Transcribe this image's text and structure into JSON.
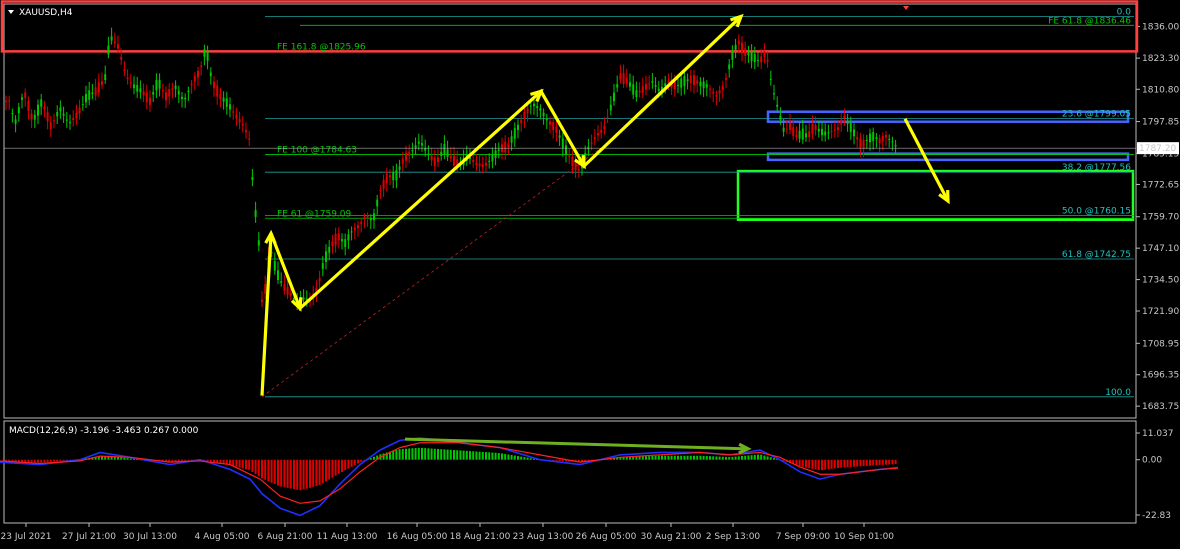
{
  "window": {
    "symbol_label": "XAUUSD,H4"
  },
  "colors": {
    "background": "#000000",
    "bull": "#00c800",
    "bear": "#e00000",
    "fib": "#20a0a0",
    "fib_text": "#20c0c0",
    "fe": "#00c800",
    "price_line": "#aaaaaa",
    "arrow": "#ffff00",
    "resistance_box": "#ff4040",
    "support_box": "#20ff20",
    "range_box": "#4466ff",
    "macd_line": "#2030ff",
    "signal_line": "#ff2020",
    "divergence": "#6fb020"
  },
  "chart_data": [
    {
      "type": "candlestick",
      "title": "XAUUSD,H4",
      "current_price": "1787.20",
      "ylim": [
        1679,
        1845
      ],
      "y_ticks": [
        "1836.00",
        "1823.30",
        "1810.80",
        "1797.85",
        "1785.15",
        "1772.65",
        "1759.70",
        "1747.10",
        "1734.50",
        "1721.90",
        "1708.95",
        "1696.35",
        "1683.75"
      ],
      "x_ticks": [
        "23 Jul 2021",
        "27 Jul 21:00",
        "30 Jul 13:00",
        "4 Aug 05:00",
        "6 Aug 21:00",
        "11 Aug 13:00",
        "16 Aug 05:00",
        "18 Aug 21:00",
        "23 Aug 13:00",
        "26 Aug 05:00",
        "30 Aug 21:00",
        "2 Sep 13:00",
        "7 Sep 09:00",
        "10 Sep 01:00"
      ],
      "price_path": [
        [
          0,
          1800
        ],
        [
          8,
          1808
        ],
        [
          15,
          1797
        ],
        [
          24,
          1810
        ],
        [
          33,
          1798
        ],
        [
          42,
          1806
        ],
        [
          51,
          1796
        ],
        [
          60,
          1803
        ],
        [
          69,
          1797
        ],
        [
          78,
          1801
        ],
        [
          87,
          1808
        ],
        [
          96,
          1810
        ],
        [
          105,
          1815
        ],
        [
          110,
          1832
        ],
        [
          118,
          1828
        ],
        [
          126,
          1816
        ],
        [
          134,
          1812
        ],
        [
          142,
          1810
        ],
        [
          150,
          1806
        ],
        [
          158,
          1814
        ],
        [
          166,
          1808
        ],
        [
          175,
          1812
        ],
        [
          184,
          1806
        ],
        [
          193,
          1814
        ],
        [
          200,
          1818
        ],
        [
          206,
          1828
        ],
        [
          212,
          1814
        ],
        [
          220,
          1808
        ],
        [
          228,
          1805
        ],
        [
          236,
          1800
        ],
        [
          244,
          1796
        ],
        [
          250,
          1790
        ],
        [
          254,
          1765
        ],
        [
          258,
          1755
        ],
        [
          262,
          1726
        ],
        [
          265,
          1730
        ],
        [
          270,
          1748
        ],
        [
          276,
          1738
        ],
        [
          283,
          1732
        ],
        [
          290,
          1729
        ],
        [
          297,
          1725
        ],
        [
          303,
          1727
        ],
        [
          310,
          1726
        ],
        [
          317,
          1730
        ],
        [
          324,
          1742
        ],
        [
          331,
          1748
        ],
        [
          338,
          1752
        ],
        [
          345,
          1749
        ],
        [
          352,
          1754
        ],
        [
          359,
          1756
        ],
        [
          366,
          1760
        ],
        [
          373,
          1758
        ],
        [
          380,
          1770
        ],
        [
          388,
          1776
        ],
        [
          396,
          1776
        ],
        [
          404,
          1783
        ],
        [
          412,
          1786
        ],
        [
          420,
          1790
        ],
        [
          428,
          1785
        ],
        [
          436,
          1781
        ],
        [
          444,
          1787
        ],
        [
          452,
          1783
        ],
        [
          460,
          1780
        ],
        [
          468,
          1784
        ],
        [
          476,
          1781
        ],
        [
          484,
          1780
        ],
        [
          492,
          1783
        ],
        [
          500,
          1787
        ],
        [
          508,
          1788
        ],
        [
          516,
          1794
        ],
        [
          524,
          1800
        ],
        [
          532,
          1805
        ],
        [
          540,
          1803
        ],
        [
          548,
          1798
        ],
        [
          556,
          1795
        ],
        [
          564,
          1788
        ],
        [
          572,
          1782
        ],
        [
          580,
          1778
        ],
        [
          588,
          1787
        ],
        [
          596,
          1792
        ],
        [
          604,
          1795
        ],
        [
          612,
          1805
        ],
        [
          620,
          1816
        ],
        [
          628,
          1814
        ],
        [
          636,
          1809
        ],
        [
          644,
          1811
        ],
        [
          652,
          1814
        ],
        [
          660,
          1810
        ],
        [
          668,
          1814
        ],
        [
          676,
          1812
        ],
        [
          684,
          1814
        ],
        [
          692,
          1815
        ],
        [
          700,
          1813
        ],
        [
          708,
          1812
        ],
        [
          716,
          1808
        ],
        [
          724,
          1812
        ],
        [
          732,
          1824
        ],
        [
          738,
          1830
        ],
        [
          744,
          1826
        ],
        [
          752,
          1824
        ],
        [
          760,
          1822
        ],
        [
          766,
          1826
        ],
        [
          772,
          1812
        ],
        [
          778,
          1803
        ],
        [
          784,
          1794
        ],
        [
          790,
          1796
        ],
        [
          796,
          1792
        ],
        [
          802,
          1793
        ],
        [
          808,
          1792
        ],
        [
          814,
          1796
        ],
        [
          820,
          1794
        ],
        [
          826,
          1793
        ],
        [
          832,
          1794
        ],
        [
          838,
          1795
        ],
        [
          844,
          1800
        ],
        [
          850,
          1796
        ],
        [
          856,
          1792
        ],
        [
          862,
          1788
        ],
        [
          868,
          1791
        ],
        [
          874,
          1792
        ],
        [
          880,
          1790
        ],
        [
          886,
          1792
        ],
        [
          892,
          1790
        ],
        [
          898,
          1787
        ]
      ],
      "fibonacci": [
        {
          "price": 1836.45,
          "label": "FE 61.8 @1836.46",
          "kind": "fe"
        },
        {
          "price": 1825.96,
          "label": "FE 161.8 @1825.96",
          "kind": "fe"
        },
        {
          "price": 1799.05,
          "label": "23.6 @1799.05",
          "kind": "fib"
        },
        {
          "price": 1784.63,
          "label": "FE 100 @1784.63",
          "kind": "fe"
        },
        {
          "price": 1777.56,
          "label": "38.2 @1777.56",
          "kind": "fib"
        },
        {
          "price": 1760.15,
          "label": "50.0 @1760.15",
          "kind": "fib"
        },
        {
          "price": 1759.09,
          "label": "FE 61 @1759.09",
          "kind": "fe"
        },
        {
          "price": 1742.75,
          "label": "61.8 @1742.75",
          "kind": "fib"
        },
        {
          "price": 1687.5,
          "label": "100.0",
          "kind": "fib"
        },
        {
          "price": 1840.0,
          "label": "0.0",
          "kind": "fib"
        }
      ],
      "zones": [
        {
          "name": "resistance",
          "from": 1826,
          "to": 1846
        },
        {
          "name": "range-top",
          "from": 1797.8,
          "to": 1801.8
        },
        {
          "name": "range-bottom",
          "from": 1782.5,
          "to": 1785.0
        },
        {
          "name": "support",
          "from": 1758.5,
          "to": 1778.0
        }
      ],
      "wave_arrow": [
        [
          262,
          1688
        ],
        [
          271,
          1753
        ],
        [
          300,
          1723
        ],
        [
          541,
          1810
        ],
        [
          584,
          1780
        ],
        [
          741,
          1840
        ]
      ],
      "forecast_arrow": [
        [
          905,
          1799
        ],
        [
          948,
          1766
        ]
      ]
    },
    {
      "type": "macd",
      "title": "MACD(12,26,9) -3.196 -3.463 0.267 0.000",
      "ylim": [
        -22.83,
        11.037
      ],
      "y_ticks": [
        "11.037",
        "0.00",
        "-22.83"
      ],
      "macd_path": [
        [
          0,
          -1
        ],
        [
          40,
          -2
        ],
        [
          80,
          0
        ],
        [
          100,
          3
        ],
        [
          130,
          1
        ],
        [
          170,
          -2
        ],
        [
          200,
          0
        ],
        [
          230,
          -4
        ],
        [
          250,
          -8
        ],
        [
          262,
          -14
        ],
        [
          280,
          -20
        ],
        [
          300,
          -23
        ],
        [
          320,
          -19
        ],
        [
          340,
          -10
        ],
        [
          360,
          -2
        ],
        [
          380,
          4
        ],
        [
          400,
          8
        ],
        [
          420,
          9
        ],
        [
          460,
          7
        ],
        [
          500,
          5
        ],
        [
          540,
          0
        ],
        [
          580,
          -2
        ],
        [
          620,
          2
        ],
        [
          660,
          3
        ],
        [
          700,
          3
        ],
        [
          730,
          2
        ],
        [
          760,
          4
        ],
        [
          780,
          0
        ],
        [
          800,
          -5
        ],
        [
          820,
          -8
        ],
        [
          840,
          -6
        ],
        [
          860,
          -5
        ],
        [
          880,
          -4
        ],
        [
          898,
          -3.2
        ]
      ],
      "signal_path": [
        [
          0,
          -0.5
        ],
        [
          40,
          -1.5
        ],
        [
          80,
          -0.5
        ],
        [
          100,
          1.5
        ],
        [
          130,
          1
        ],
        [
          170,
          -1
        ],
        [
          200,
          -0.5
        ],
        [
          230,
          -2
        ],
        [
          260,
          -8
        ],
        [
          280,
          -15
        ],
        [
          300,
          -18
        ],
        [
          320,
          -17
        ],
        [
          340,
          -12
        ],
        [
          360,
          -5
        ],
        [
          380,
          1
        ],
        [
          400,
          5
        ],
        [
          420,
          7
        ],
        [
          460,
          7
        ],
        [
          500,
          5
        ],
        [
          540,
          2
        ],
        [
          580,
          -1
        ],
        [
          620,
          1
        ],
        [
          660,
          2
        ],
        [
          700,
          3
        ],
        [
          730,
          2
        ],
        [
          760,
          3
        ],
        [
          780,
          1
        ],
        [
          800,
          -3
        ],
        [
          820,
          -6
        ],
        [
          840,
          -6
        ],
        [
          860,
          -5
        ],
        [
          880,
          -4
        ],
        [
          898,
          -3.46
        ]
      ],
      "divergence_arrow": [
        [
          405,
          8.5
        ],
        [
          748,
          4.5
        ]
      ]
    }
  ]
}
